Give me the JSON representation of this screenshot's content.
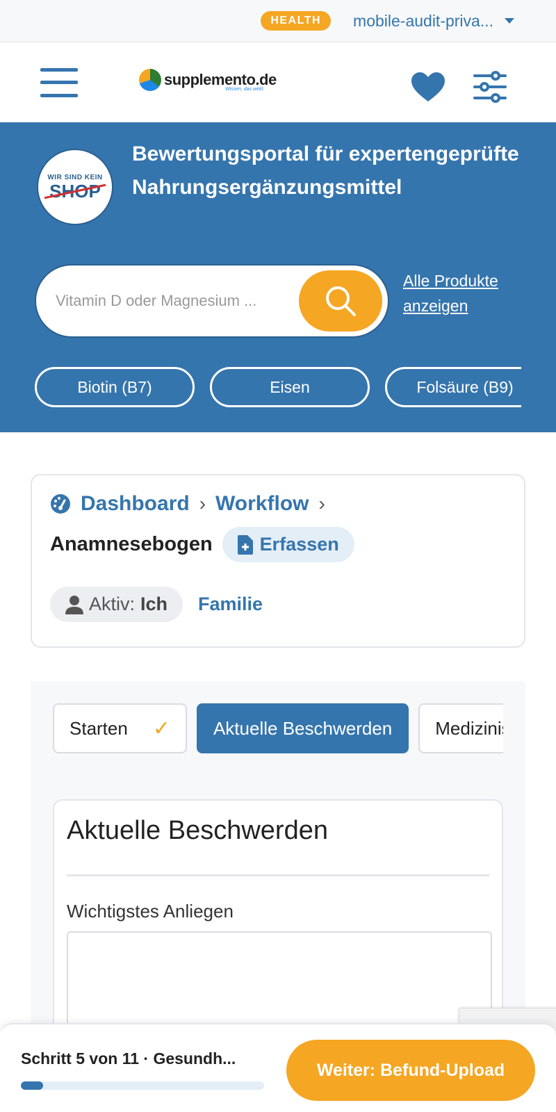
{
  "topbar": {
    "badge": "HEALTH",
    "account": "mobile-audit-priva..."
  },
  "header": {
    "logo_text": "supplemento.de",
    "logo_tagline": "Wissen, das wirkt."
  },
  "hero": {
    "badge_top": "WIR SIND KEIN",
    "badge_bottom": "SHOP",
    "title": "Bewertungsportal für expertengeprüfte Nahrungsergänzungsmittel",
    "search_placeholder": "Vitamin D oder Magnesium ...",
    "all_products_line1": "Alle Produkte",
    "all_products_line2": "anzeigen",
    "chips": [
      "Biotin (B7)",
      "Eisen",
      "Folsäure (B9)"
    ]
  },
  "breadcrumb": {
    "items": [
      "Dashboard",
      "Workflow"
    ],
    "separator": "›",
    "current": "Anamnesebogen",
    "action": "Erfassen",
    "active_label": "Aktiv:",
    "active_value": "Ich",
    "other_profile": "Familie"
  },
  "workflow": {
    "steps": [
      {
        "label": "Starten",
        "done": true
      },
      {
        "label": "Aktuelle Beschwerden",
        "active": true
      },
      {
        "label": "Medizinische Vorgeschichte"
      }
    ],
    "check_glyph": "✓",
    "form_title": "Aktuelle Beschwerden",
    "field_label": "Wichtigstes Anliegen"
  },
  "bottombar": {
    "step_info": "Schritt 5 von 11 · Gesundh...",
    "progress": 0.09,
    "next_label": "Weiter: Befund-Upload"
  },
  "colors": {
    "primary": "#3575ad",
    "accent": "#f5a623"
  }
}
